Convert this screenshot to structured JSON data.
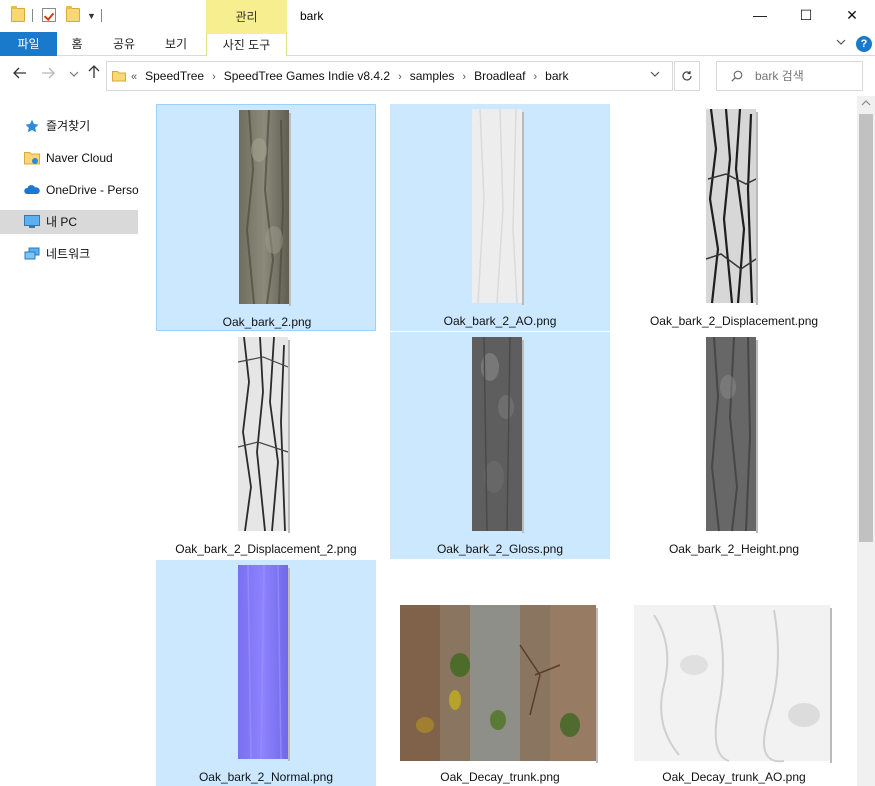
{
  "window": {
    "title": "bark",
    "context_group_label": "관리",
    "controls": {
      "minimize": "—",
      "maximize": "☐",
      "close": "✕"
    }
  },
  "ribbon": {
    "file_tab": "파일",
    "tabs": [
      "홈",
      "공유",
      "보기"
    ],
    "context_tab": "사진 도구",
    "help": "?"
  },
  "address": {
    "prefix": "«",
    "crumbs": [
      "SpeedTree",
      "SpeedTree Games Indie v8.4.2",
      "samples",
      "Broadleaf",
      "bark"
    ],
    "separator": "›"
  },
  "search": {
    "placeholder": "bark 검색"
  },
  "navpane": {
    "items": [
      {
        "label": "즐겨찾기",
        "icon": "star-icon"
      },
      {
        "label": "Naver Cloud",
        "icon": "cloud-folder-icon"
      },
      {
        "label": "OneDrive - Perso",
        "icon": "onedrive-icon"
      },
      {
        "label": "내 PC",
        "icon": "pc-icon",
        "selected": true
      },
      {
        "label": "네트워크",
        "icon": "network-icon"
      }
    ]
  },
  "files": [
    {
      "name": "Oak_bark_2.png",
      "selected": true,
      "focused": true,
      "kind": "bark-color"
    },
    {
      "name": "Oak_bark_2_AO.png",
      "selected": true,
      "kind": "bark-ao"
    },
    {
      "name": "Oak_bark_2_Displacement.png",
      "selected": false,
      "kind": "bark-disp"
    },
    {
      "name": "Oak_bark_2_Displacement_2.png",
      "selected": false,
      "kind": "bark-disp2"
    },
    {
      "name": "Oak_bark_2_Gloss.png",
      "selected": true,
      "kind": "bark-gloss"
    },
    {
      "name": "Oak_bark_2_Height.png",
      "selected": false,
      "kind": "bark-height"
    },
    {
      "name": "Oak_bark_2_Normal.png",
      "selected": true,
      "kind": "bark-normal"
    },
    {
      "name": "Oak_Decay_trunk.png",
      "selected": false,
      "kind": "decay-color"
    },
    {
      "name": "Oak_Decay_trunk_AO.png",
      "selected": false,
      "kind": "decay-ao"
    }
  ],
  "colors": {
    "file_tab": "#1979ca",
    "selection": "#cce8ff",
    "context_tab": "#f6ee8f"
  }
}
